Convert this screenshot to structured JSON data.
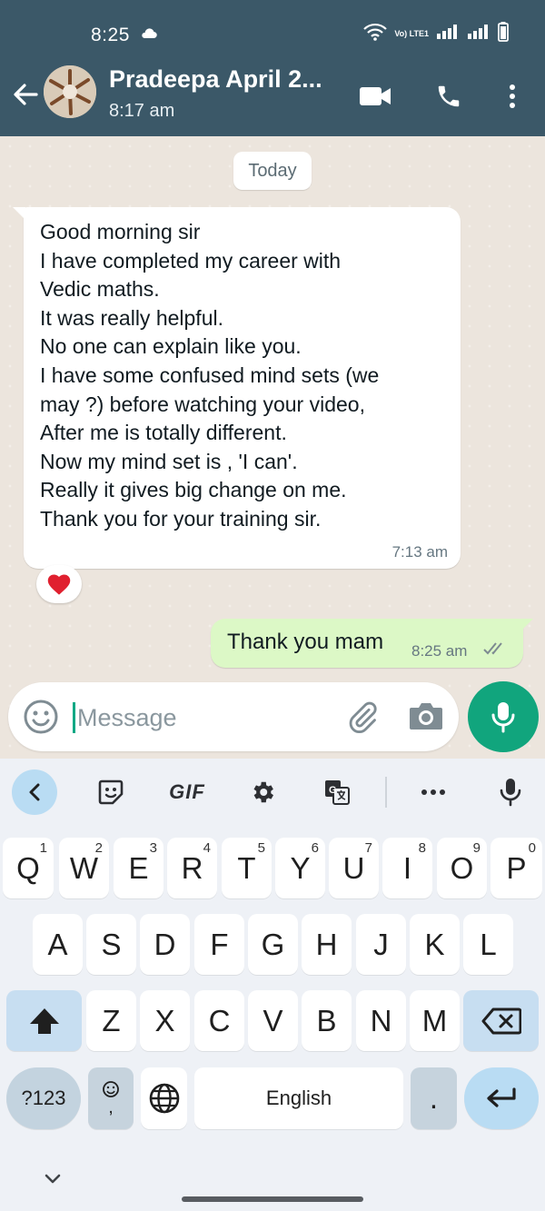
{
  "status_bar": {
    "time": "8:25",
    "volte_label": "Vo) LTE1"
  },
  "header": {
    "contact_name": "Pradeepa April 2...",
    "last_seen": "8:17 am",
    "colors": {
      "header_bg": "#3b5868"
    }
  },
  "chat": {
    "date_label": "Today",
    "incoming": {
      "lines": [
        "Good morning sir",
        "I have completed my career with",
        "Vedic maths.",
        "It was really helpful.",
        "No one can explain like you.",
        "I have some confused mind sets (we",
        "may ?) before watching your video,",
        "After me is totally different.",
        "Now my mind set is ,  'I can'.",
        "Really it gives big change on me.",
        "Thank you for your training sir."
      ],
      "time": "7:13 am",
      "reaction": "heart-icon"
    },
    "outgoing": {
      "text": "Thank you mam",
      "time": "8:25 am",
      "status": "double-check-read"
    }
  },
  "composer": {
    "placeholder": "Message"
  },
  "keyboard": {
    "toolbar": {
      "gif_label": "GIF"
    },
    "row1": [
      {
        "key": "Q",
        "hint": "1"
      },
      {
        "key": "W",
        "hint": "2"
      },
      {
        "key": "E",
        "hint": "3"
      },
      {
        "key": "R",
        "hint": "4"
      },
      {
        "key": "T",
        "hint": "5"
      },
      {
        "key": "Y",
        "hint": "6"
      },
      {
        "key": "U",
        "hint": "7"
      },
      {
        "key": "I",
        "hint": "8"
      },
      {
        "key": "O",
        "hint": "9"
      },
      {
        "key": "P",
        "hint": "0"
      }
    ],
    "row2": [
      "A",
      "S",
      "D",
      "F",
      "G",
      "H",
      "J",
      "K",
      "L"
    ],
    "row3": [
      "Z",
      "X",
      "C",
      "V",
      "B",
      "N",
      "M"
    ],
    "symbols_label": "?123",
    "comma": ",",
    "space_label": "English",
    "period": "."
  }
}
